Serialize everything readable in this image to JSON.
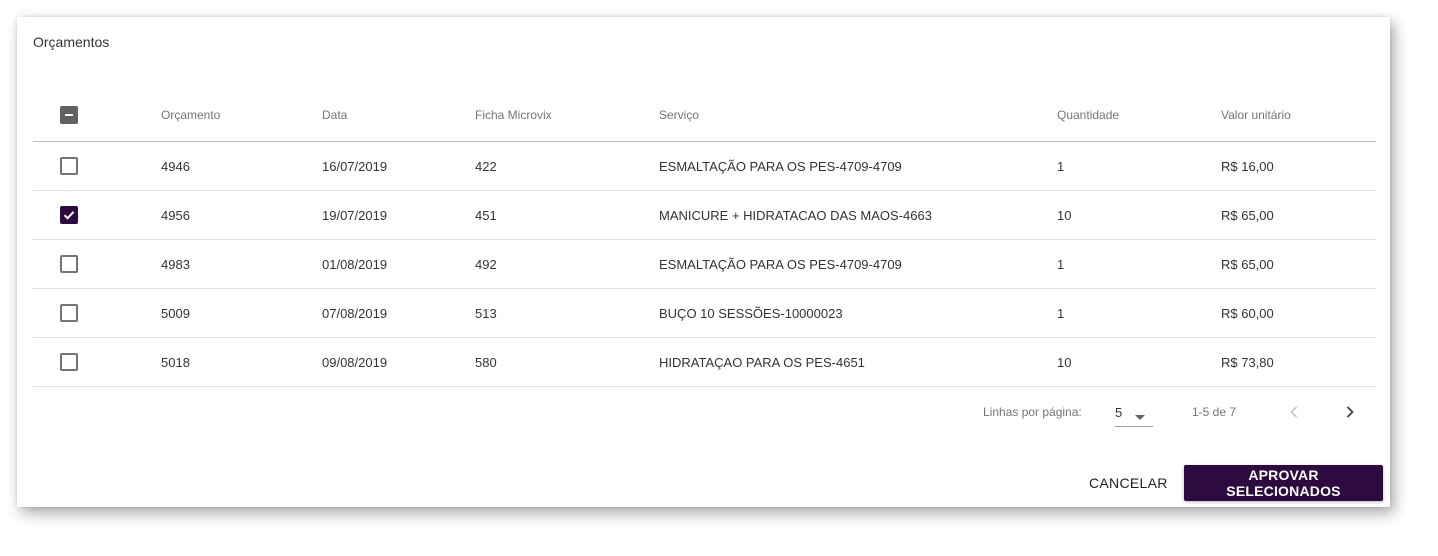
{
  "dialog": {
    "title": "Orçamentos"
  },
  "table": {
    "headers": [
      "Orçamento",
      "Data",
      "Ficha Microvix",
      "Serviço",
      "Quantidade",
      "Valor unitário"
    ],
    "select_all_state": "indeterminate",
    "rows": [
      {
        "checked": false,
        "orcamento": "4946",
        "data": "16/07/2019",
        "ficha": "422",
        "servico": "ESMALTAÇÃO PARA OS PES-4709-4709",
        "quantidade": "1",
        "valor": "R$ 16,00"
      },
      {
        "checked": true,
        "orcamento": "4956",
        "data": "19/07/2019",
        "ficha": "451",
        "servico": "MANICURE + HIDRATACAO DAS MAOS-4663",
        "quantidade": "10",
        "valor": "R$ 65,00"
      },
      {
        "checked": false,
        "orcamento": "4983",
        "data": "01/08/2019",
        "ficha": "492",
        "servico": "ESMALTAÇÃO PARA OS PES-4709-4709",
        "quantidade": "1",
        "valor": "R$ 65,00"
      },
      {
        "checked": false,
        "orcamento": "5009",
        "data": "07/08/2019",
        "ficha": "513",
        "servico": "BUÇO 10 SESSÕES-10000023",
        "quantidade": "1",
        "valor": "R$ 60,00"
      },
      {
        "checked": false,
        "orcamento": "5018",
        "data": "09/08/2019",
        "ficha": "580",
        "servico": "HIDRATAÇAO PARA OS PES-4651",
        "quantidade": "10",
        "valor": "R$ 73,80"
      }
    ]
  },
  "pagination": {
    "rows_per_page_label": "Linhas por página:",
    "rows_per_page_value": "5",
    "range_label": "1-5 de 7",
    "prev_icon": "chevron-left-icon",
    "next_icon": "chevron-right-icon"
  },
  "actions": {
    "cancel_label": "CANCELAR",
    "approve_label": "APROVAR SELECIONADOS"
  },
  "colors": {
    "primary": "#2d0a3f",
    "header_text": "#757575",
    "divider": "#e0e0e0"
  }
}
